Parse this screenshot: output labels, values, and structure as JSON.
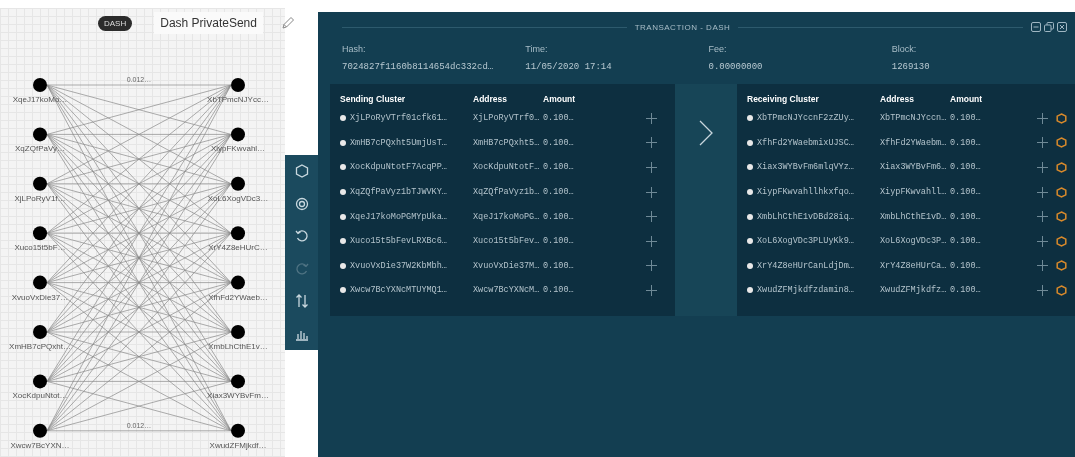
{
  "graph": {
    "badge": "DASH",
    "title": "Dash PrivateSend",
    "inputs": [
      "XqeJ17koMo…",
      "XqZQfPaVy…",
      "XjLPoRyV1f…",
      "Xuco15t5bF…",
      "XvuoVxDie37…",
      "XmHB7cPQxht…",
      "XocKdpuNtot…",
      "Xwcw7BcYXN…"
    ],
    "outputs": [
      "XbTPmcNJYcc…",
      "XiypFKwvahl…",
      "XoL6XogVDc3…",
      "XrY4Z8eHUrC…",
      "XfhFd2YWaeb…",
      "XmbLhCthE1v…",
      "Xiax3WYBvFm…",
      "XwudZFMjkdf…"
    ],
    "edge_labels": [
      "0.012…",
      "0.012…"
    ]
  },
  "toolbar": [
    {
      "kind": "hexagon",
      "disabled": false
    },
    {
      "kind": "target",
      "disabled": false
    },
    {
      "kind": "undo",
      "disabled": false
    },
    {
      "kind": "redo",
      "disabled": true
    },
    {
      "kind": "sort",
      "disabled": false
    },
    {
      "kind": "chart",
      "disabled": false
    }
  ],
  "panel": {
    "title": "TRANSACTION - DASH",
    "fields": [
      {
        "label": "Hash:",
        "value": "7024827f1160b8114654dc332cd…"
      },
      {
        "label": "Time:",
        "value": "11/05/2020 17:14"
      },
      {
        "label": "Fee:",
        "value": "0.00000000"
      },
      {
        "label": "Block:",
        "value": "1269130"
      }
    ],
    "sending": {
      "columns": [
        "Sending Cluster",
        "Address",
        "Amount"
      ],
      "rows": [
        {
          "cluster": "XjLPoRyVTrf01cfk61…",
          "address": "XjLPoRyVTrf0…",
          "amount": "0.100…"
        },
        {
          "cluster": "XmHB7cPQxht5UmjUsT…",
          "address": "XmHB7cPQxht5…",
          "amount": "0.100…"
        },
        {
          "cluster": "XocKdpuNtotF7AcqPP…",
          "address": "XocKdpuNtotF…",
          "amount": "0.100…"
        },
        {
          "cluster": "XqZQfPaVyz1bTJWVKY…",
          "address": "XqZQfPaVyz1b…",
          "amount": "0.100…"
        },
        {
          "cluster": "XqeJ17koMoPGMYpUka…",
          "address": "XqeJ17koMoPG…",
          "amount": "0.100…"
        },
        {
          "cluster": "Xuco15t5bFevLRXBc6…",
          "address": "Xuco15t5bFev…",
          "amount": "0.100…"
        },
        {
          "cluster": "XvuoVxDie37W2KbMbh…",
          "address": "XvuoVxDie37M…",
          "amount": "0.100…"
        },
        {
          "cluster": "Xwcw7BcYXNcMTUYMQ1…",
          "address": "Xwcw7BcYXNcM…",
          "amount": "0.100…"
        }
      ]
    },
    "receiving": {
      "columns": [
        "Receiving Cluster",
        "Address",
        "Amount"
      ],
      "rows": [
        {
          "cluster": "XbTPmcNJYccnF2zZUy…",
          "address": "XbTPmcNJYccn…",
          "amount": "0.100…"
        },
        {
          "cluster": "XfhFd2YWaebmixUJSC…",
          "address": "XfhFd2YWaebm…",
          "amount": "0.100…"
        },
        {
          "cluster": "Xiax3WYBvFm6mlqVYz…",
          "address": "Xiax3WYBvFm6…",
          "amount": "0.100…"
        },
        {
          "cluster": "XiypFKwvahllhkxfqo…",
          "address": "XiypFKwvahll…",
          "amount": "0.100…"
        },
        {
          "cluster": "XmbLhCthE1vDBd28iq…",
          "address": "XmbLhCthE1vD…",
          "amount": "0.100…"
        },
        {
          "cluster": "XoL6XogVDc3PLUyKk9…",
          "address": "XoL6XogVDc3P…",
          "amount": "0.100…"
        },
        {
          "cluster": "XrY4Z8eHUrCanLdjDm…",
          "address": "XrY4Z8eHUrCa…",
          "amount": "0.100…"
        },
        {
          "cluster": "XwudZFMjkdfzdamin8…",
          "address": "XwudZFMjkdfz…",
          "amount": "0.100…"
        }
      ]
    }
  }
}
